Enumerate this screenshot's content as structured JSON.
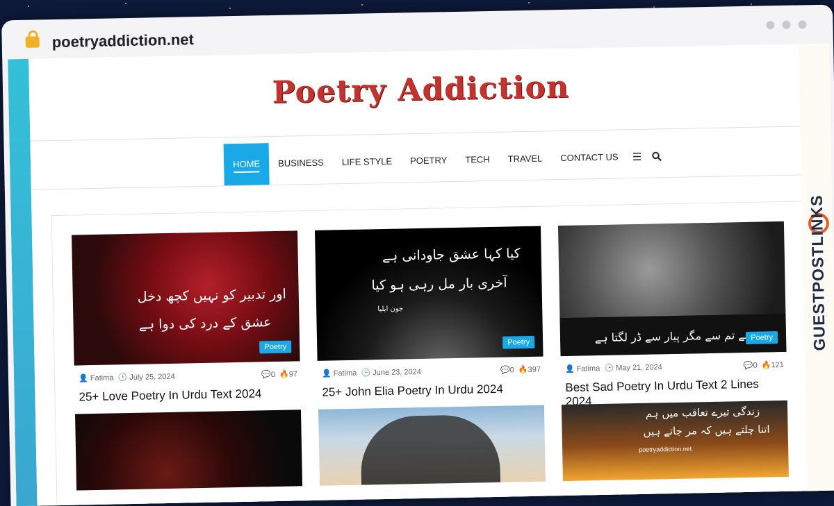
{
  "browser": {
    "url": "poetryaddiction.net"
  },
  "site": {
    "logo_text": "Poetry Addiction"
  },
  "nav": {
    "items": [
      "HOME",
      "BUSINESS",
      "LIFE STYLE",
      "POETRY",
      "TECH",
      "TRAVEL",
      "CONTACT US"
    ],
    "menu_icon": "☰",
    "search_icon": "🔍"
  },
  "watermark": {
    "text": "GUESTPOSTLINKS"
  },
  "posts": [
    {
      "author": "Fatima",
      "date": "July 25, 2024",
      "comments": "0",
      "views": "97",
      "category": "Poetry",
      "title": "25+ Love Poetry In Urdu Text 2024",
      "image_text": [
        "اور تدبیر کو نہیں کچھ دخل",
        "عشق کے درد کی دوا ہے"
      ]
    },
    {
      "author": "Fatima",
      "date": "June 23, 2024",
      "comments": "0",
      "views": "397",
      "category": "Poetry",
      "title": "25+ John Elia Poetry In Urdu 2024",
      "image_text": [
        "کیا کہا عشق جاودانی ہے",
        "آخری بار مل رہی ہو کیا",
        "جون ایلیا"
      ]
    },
    {
      "author": "Fatima",
      "date": "May 21, 2024",
      "comments": "0",
      "views": "121",
      "category": "Poetry",
      "title": "Best Sad Poetry In Urdu Text 2 Lines 2024",
      "image_text": [
        "ہے تم سے مگر پیار سے ڈر لگتا ہے"
      ]
    }
  ],
  "row2": {
    "image_text": [
      "زندگی تیرے تعاقب میں ہم",
      "اتنا چلتے ہیں کہ مر جاتے ہیں",
      "poetryaddiction.net"
    ]
  },
  "colors": {
    "accent": "#19a9e6",
    "logo": "#c2332e"
  }
}
